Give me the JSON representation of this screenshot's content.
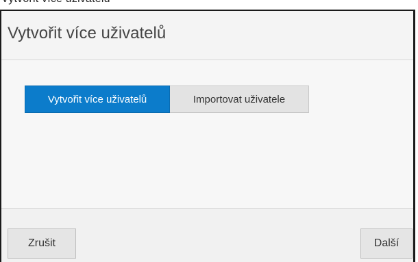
{
  "top_strip": {
    "text": "Vytvořit více uživatelů"
  },
  "dialog": {
    "title": "Vytvořit více uživatelů",
    "tabs": [
      {
        "label": "Vytvořit více uživatelů",
        "active": true
      },
      {
        "label": "Importovat uživatele",
        "active": false
      }
    ],
    "footer": {
      "cancel_label": "Zrušit",
      "next_label": "Další"
    }
  },
  "colors": {
    "accent": "#0c7ccb",
    "header_bg": "#f4f4f4",
    "body_bg": "#f7f7f7"
  }
}
